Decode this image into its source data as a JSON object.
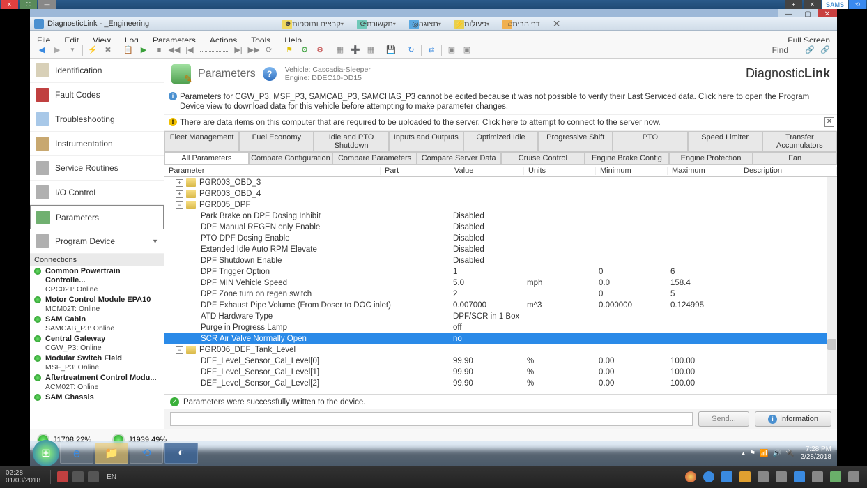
{
  "outer": {
    "sams": "SAMS",
    "clock_time": "02:28",
    "clock_date": "01/03/2018",
    "lang": "EN"
  },
  "app": {
    "title": "DiagnosticLink - _Engineering",
    "menubar": [
      "File",
      "Edit",
      "View",
      "Log",
      "Parameters",
      "Actions",
      "Tools",
      "Help"
    ],
    "full_screen": "Full Screen",
    "find": "Find",
    "brand_a": "Diagnostic",
    "brand_b": "Link"
  },
  "browser_tabs": [
    {
      "label": "דף הבית"
    },
    {
      "label": "פעולות"
    },
    {
      "label": "תצוגה"
    },
    {
      "label": "תקשורת"
    },
    {
      "label": "קבצים ותוספות"
    }
  ],
  "nav": [
    {
      "label": "Identification",
      "icon": "#d8d0b8"
    },
    {
      "label": "Fault Codes",
      "icon": "#c04040"
    },
    {
      "label": "Troubleshooting",
      "icon": "#a8c8e8"
    },
    {
      "label": "Instrumentation",
      "icon": "#c8a870"
    },
    {
      "label": "Service Routines",
      "icon": "#b0b0b0"
    },
    {
      "label": "I/O Control",
      "icon": "#b0b0b0"
    },
    {
      "label": "Parameters",
      "icon": "#70b070",
      "selected": true
    },
    {
      "label": "Program Device",
      "icon": "#b0b0b0"
    }
  ],
  "connections_hdr": "Connections",
  "connections": [
    {
      "name": "Common Powertrain Controlle...",
      "sub": "CPC02T: Online"
    },
    {
      "name": "Motor Control Module EPA10",
      "sub": "MCM02T: Online"
    },
    {
      "name": "SAM Cabin",
      "sub": "SAMCAB_P3: Online"
    },
    {
      "name": "Central Gateway",
      "sub": "CGW_P3: Online"
    },
    {
      "name": "Modular Switch Field",
      "sub": "MSF_P3: Online"
    },
    {
      "name": "Aftertreatment Control Modu...",
      "sub": "ACM02T: Online"
    },
    {
      "name": "SAM Chassis",
      "sub": ""
    }
  ],
  "header": {
    "title": "Parameters",
    "vehicle": "Vehicle: Cascadia-Sleeper",
    "engine": "Engine: DDEC10-DD15"
  },
  "msg1": "Parameters for CGW_P3, MSF_P3, SAMCAB_P3, SAMCHAS_P3 cannot be edited because it was not possible to verify their Last Serviced data. Click here to open the Program Device view to download data for this vehicle before attempting to make parameter changes.",
  "msg2": "There are data items on this computer that are required to be uploaded to the server. Click here to attempt to connect to the server now.",
  "tabs1": [
    "Fleet Management",
    "Fuel Economy",
    "Idle and PTO Shutdown",
    "Inputs and Outputs",
    "Optimized Idle",
    "Progressive Shift",
    "PTO",
    "Speed Limiter",
    "Transfer Accumulators"
  ],
  "tabs2": [
    "All Parameters",
    "Compare Configuration",
    "Compare Parameters",
    "Compare Server Data",
    "Cruise Control",
    "Engine Brake Config",
    "Engine Protection",
    "Fan"
  ],
  "columns": [
    "Parameter",
    "Part",
    "Value",
    "Units",
    "Minimum",
    "Maximum",
    "Description"
  ],
  "groups_top": [
    {
      "exp": "+",
      "name": "PGR003_OBD_3"
    },
    {
      "exp": "+",
      "name": "PGR003_OBD_4"
    },
    {
      "exp": "−",
      "name": "PGR005_DPF"
    }
  ],
  "rows": [
    {
      "param": "Park Brake on DPF Dosing Inhibit",
      "value": "Disabled"
    },
    {
      "param": "DPF Manual REGEN only Enable",
      "value": "Disabled"
    },
    {
      "param": "PTO DPF Dosing Enable",
      "value": "Disabled"
    },
    {
      "param": "Extended Idle Auto RPM Elevate",
      "value": "Disabled"
    },
    {
      "param": "DPF Shutdown Enable",
      "value": "Disabled"
    },
    {
      "param": "DPF Trigger Option",
      "value": "1",
      "min": "0",
      "max": "6"
    },
    {
      "param": "DPF MIN Vehicle Speed",
      "value": "5.0",
      "units": "mph",
      "min": "0.0",
      "max": "158.4"
    },
    {
      "param": "DPF Zone turn on regen switch",
      "value": "2",
      "min": "0",
      "max": "5"
    },
    {
      "param": "DPF Exhaust Pipe Volume (From Doser to DOC inlet)",
      "value": "0.007000",
      "units": "m^3",
      "min": "0.000000",
      "max": "0.124995"
    },
    {
      "param": "ATD Hardware Type",
      "value": "DPF/SCR in 1 Box"
    },
    {
      "param": "Purge in Progress Lamp",
      "value": "off"
    },
    {
      "param": "SCR Air Valve Normally Open",
      "value": "no",
      "selected": true
    }
  ],
  "group_mid": {
    "exp": "−",
    "name": "PGR006_DEF_Tank_Level"
  },
  "rows2": [
    {
      "param": "DEF_Level_Sensor_Cal_Level[0]",
      "value": "99.90",
      "units": "%",
      "min": "0.00",
      "max": "100.00"
    },
    {
      "param": "DEF_Level_Sensor_Cal_Level[1]",
      "value": "99.90",
      "units": "%",
      "min": "0.00",
      "max": "100.00"
    },
    {
      "param": "DEF_Level_Sensor_Cal_Level[2]",
      "value": "99.90",
      "units": "%",
      "min": "0.00",
      "max": "100.00"
    }
  ],
  "status": "Parameters were successfully written to the device.",
  "send": "Send...",
  "info_btn": "Information",
  "j1708": "J1708 22%",
  "j1939": "J1939 49%",
  "win_clock": {
    "time": "7:28 PM",
    "date": "2/28/2018"
  }
}
